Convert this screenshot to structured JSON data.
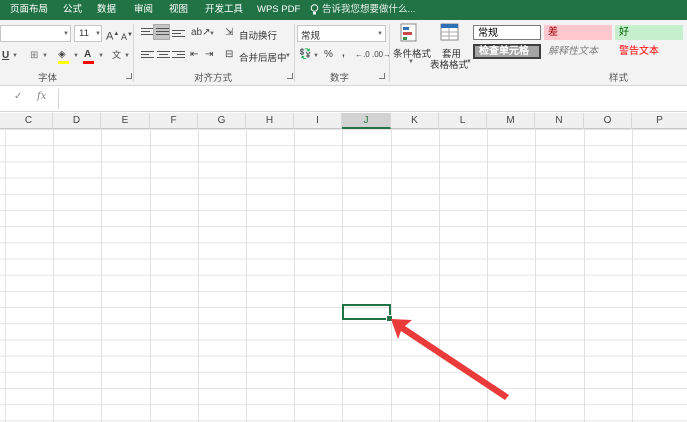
{
  "tabs": [
    "页面布局",
    "公式",
    "数据",
    "审阅",
    "视图",
    "开发工具",
    "WPS PDF"
  ],
  "tell_me": "告诉我您想要做什么...",
  "font": {
    "size": "11",
    "group_label": "字体"
  },
  "alignment": {
    "wrap_text": "自动换行",
    "merge_center": "合并后居中",
    "group_label": "对齐方式"
  },
  "number": {
    "format": "常规",
    "percent": "%",
    "comma": ",",
    "group_label": "数字"
  },
  "styles": {
    "conditional_format": "条件格式",
    "table_format_line1": "套用",
    "table_format_line2": "表格格式",
    "normal": "常规",
    "bad": "差",
    "good": "好",
    "check_cell": "检查单元格",
    "explanatory": "解释性文本",
    "warning": "警告文本",
    "group_label": "样式"
  },
  "formula_bar": {
    "cancel": "✕",
    "enter": "✓",
    "fx": "fx",
    "value": ""
  },
  "columns": [
    "C",
    "D",
    "E",
    "F",
    "G",
    "H",
    "I",
    "J",
    "K",
    "L",
    "M",
    "N",
    "O",
    "P"
  ],
  "selected_column": "J",
  "colors": {
    "brand": "#217346",
    "bad_bg": "#ffc7ce",
    "bad_text": "#9c0006",
    "good_bg": "#c6efce",
    "good_text": "#006100",
    "check_bg": "#a5a5a5",
    "warning_text": "#ff0000",
    "arrow": "#ea3a3a"
  }
}
